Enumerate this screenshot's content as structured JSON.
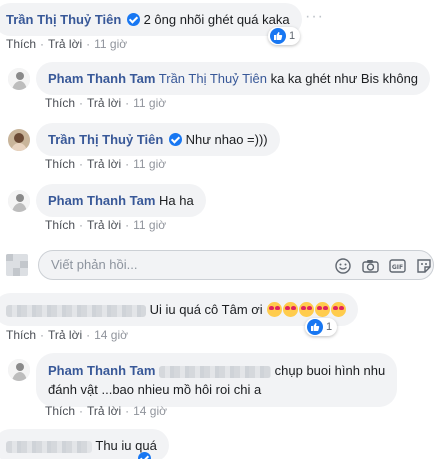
{
  "comments": [
    {
      "name": "Trần Thị Thuỷ Tiên",
      "text": "2 ông nhõi ghét quá kaka",
      "like": "Thích",
      "reply": "Trả lời",
      "time": "11 giờ",
      "reaction_count": "1",
      "more": "···"
    },
    {
      "name": "Pham Thanh Tam",
      "mention": "Trần Thị Thuỷ Tiên",
      "text": "ka ka ghét như Bis không",
      "like": "Thích",
      "reply": "Trả lời",
      "time": "11 giờ"
    },
    {
      "name": "Trần Thị Thuỷ Tiên",
      "text": "Như nhao =)))",
      "like": "Thích",
      "reply": "Trả lời",
      "time": "11 giờ"
    },
    {
      "name": "Pham Thanh Tam",
      "text": "Ha ha",
      "like": "Thích",
      "reply": "Trả lời",
      "time": "11 giờ"
    },
    {
      "text": "Ui iu quá cô Tâm ơi",
      "like": "Thích",
      "reply": "Trả lời",
      "time": "14 giờ",
      "reaction_count": "1"
    },
    {
      "name": "Pham Thanh Tam",
      "text_line1": "chụp buoi hình nhu",
      "text_line2": "đánh vật ...bao nhieu mồ hôi roi chi a",
      "like": "Thích",
      "reply": "Trả lời",
      "time": "14 giờ"
    },
    {
      "text": "Thu iu quá"
    }
  ],
  "reply_box": {
    "placeholder": "Viết phản hồi..."
  },
  "colors": {
    "name": "#385898",
    "bubble": "#f2f3f5",
    "like_blue": "#1877f2",
    "meta": "#90949c"
  },
  "icons": [
    "like-icon",
    "verified-icon",
    "smiley-icon",
    "camera-icon",
    "gif-icon",
    "sticker-icon",
    "more-icon",
    "heart-eyes-emoji"
  ]
}
